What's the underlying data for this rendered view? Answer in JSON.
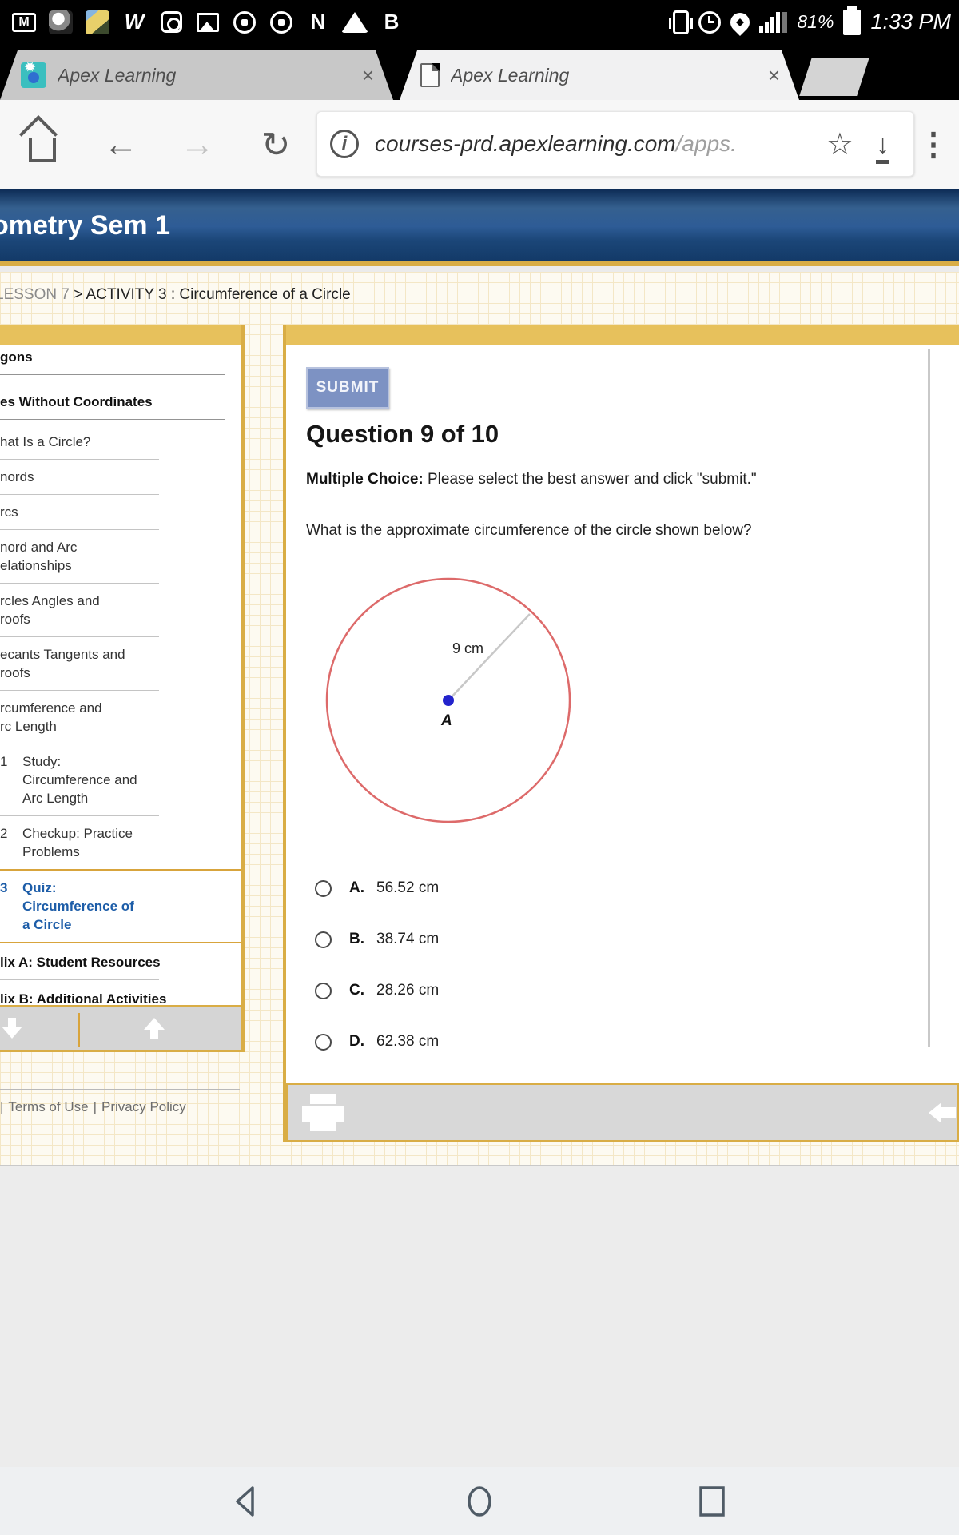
{
  "colors": {
    "accent_gold": "#e7c15c",
    "gold_border": "#d9ad45",
    "header_blue": "#2e5c96",
    "active_link_blue": "#1d5da8",
    "submit_bg": "#7d92c3",
    "circle_stroke": "#dd6a6a",
    "center_dot_blue": "#2323cc"
  },
  "status_bar": {
    "time": "1:33 PM",
    "battery_percent": "81%",
    "letters": {
      "m": "M",
      "w": "W",
      "n": "N",
      "b": "B"
    }
  },
  "tab_bar": {
    "tabs": [
      {
        "title": "Apex Learning",
        "close": "×"
      },
      {
        "title": "Apex Learning",
        "close": "×"
      }
    ]
  },
  "toolbar": {
    "home": "⌂",
    "back": "←",
    "forward": "→",
    "reload": "↻",
    "info": "i",
    "url_host": "courses-prd.apexlearning.com",
    "url_path": "/apps.",
    "star": "☆",
    "download": "↓",
    "menu": "⋮"
  },
  "course_header": {
    "title": "ometry Sem 1"
  },
  "breadcrumb": {
    "lesson": "LESSON 7",
    "separator": " > ",
    "activity": "ACTIVITY 3 : Circumference of a Circle"
  },
  "sidebar": {
    "items": [
      {
        "label": "gons",
        "type": "header"
      },
      {
        "label": "es Without Coordinates",
        "type": "header"
      },
      {
        "label": "hat Is a Circle?",
        "type": "item"
      },
      {
        "label": "nords",
        "type": "item"
      },
      {
        "label": "rcs",
        "type": "item"
      },
      {
        "label": "nord and Arc\nelationships",
        "type": "item"
      },
      {
        "label": "rcles Angles and\nroofs",
        "type": "item"
      },
      {
        "label": "ecants Tangents and\nroofs",
        "type": "item"
      },
      {
        "label": "rcumference and\nrc Length",
        "type": "item"
      },
      {
        "num": "1",
        "label": "Study:\nCircumference and\nArc Length",
        "type": "numbered"
      },
      {
        "num": "2",
        "label": "Checkup: Practice\nProblems",
        "type": "numbered"
      },
      {
        "num": "3",
        "label": "Quiz:\nCircumference of\na Circle",
        "type": "numbered-active"
      },
      {
        "label": "lix A: Student Resources",
        "type": "header"
      },
      {
        "label": "lix B: Additional Activities",
        "type": "header"
      }
    ],
    "footer": {
      "sep1": "|",
      "terms": "Terms of Use",
      "sep2": "|",
      "privacy": "Privacy Policy"
    }
  },
  "quiz": {
    "submit_label": "SUBMIT",
    "question_title": "Question 9 of 10",
    "instruction_bold": "Multiple Choice:",
    "instruction_rest": " Please select the best answer and click \"submit.\"",
    "question_text": "What is the approximate circumference of the circle shown below?",
    "figure": {
      "radius_label": "9 cm",
      "center_label": "A"
    },
    "options": [
      {
        "letter": "A.",
        "text": "56.52 cm"
      },
      {
        "letter": "B.",
        "text": "38.74 cm"
      },
      {
        "letter": "C.",
        "text": "28.26 cm"
      },
      {
        "letter": "D.",
        "text": "62.38 cm"
      }
    ]
  }
}
